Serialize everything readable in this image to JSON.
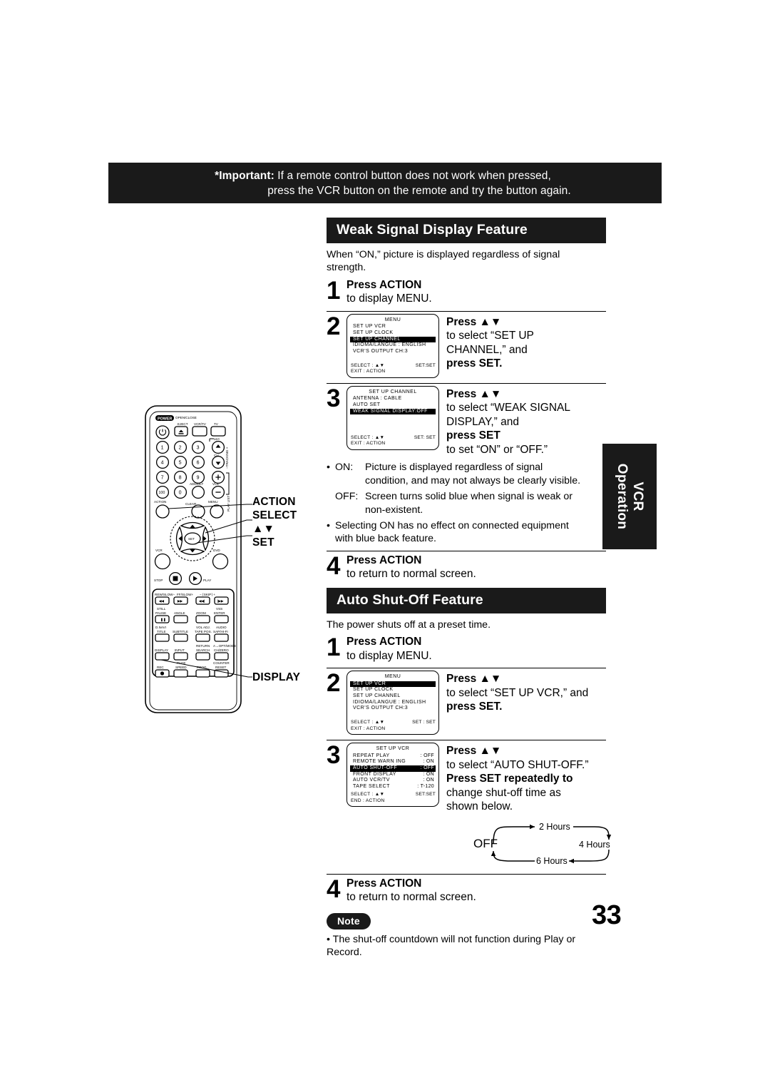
{
  "page": {
    "number": "33",
    "side_tab": "VCR\nOperation",
    "side_tab_line1": "VCR",
    "side_tab_line2": "Operation"
  },
  "important": {
    "label": "*Important:",
    "line1": " If a remote control button does not work when pressed,",
    "line2": "press the VCR button on the remote and try the button again."
  },
  "remote": {
    "callouts": [
      {
        "label": "ACTION"
      },
      {
        "label": "SELECT"
      },
      {
        "label": "▲▼"
      },
      {
        "label": "SET"
      }
    ],
    "display_callout": "DISPLAY",
    "buttons": {
      "power": "POWER",
      "open_close": "OPEN/CLOSE",
      "eject": "EJECT",
      "vcr_tv": "VCR/TV",
      "tv": "TV",
      "ch": "CH",
      "tracking": "TRACKING",
      "over10": "≥10",
      "add_dlt": "ADD/DLT",
      "vol": "VOL",
      "action": "ACTION",
      "clear": "CLEAR",
      "menu": "MENU",
      "play_list": "PLAY LIST",
      "set": "SET",
      "vcr": "VCR",
      "dvd": "DVD",
      "stop": "STOP",
      "play": "PLAY",
      "rew_slow": "REW/SLOW−",
      "ff_slow": "FF/SLOW+",
      "skip": "SKIP",
      "still_pause": "STILL PAUSE",
      "angle": "ANGLE",
      "zoom": "ZOOM",
      "vss_enter": "VSS ENTER",
      "dnavi_title": "D.NAVI TITLE",
      "subtitle": "SUBTITLE",
      "vol_adj_tape_pos": "VOL ADJ. TAPE POS.",
      "audio": "AUDIO SAP/HI-FI",
      "display": "DISPLAY",
      "input": "INPUT",
      "return_search": "RETURN SEARCH",
      "ch_zero": "A→ OPT/MODE CH/ZERO",
      "rec": "REC",
      "page_speed": "PAGE SPEED",
      "prog": "PROG",
      "counter_reset": "COUNTER RESET",
      "numbers": [
        "1",
        "2",
        "3",
        "4",
        "5",
        "6",
        "7",
        "8",
        "9",
        "100",
        "0"
      ]
    }
  },
  "sections": [
    {
      "title": "Weak Signal Display Feature",
      "intro": "When “ON,” picture is displayed regardless of signal strength.",
      "steps": [
        {
          "num": "1",
          "lines": [
            {
              "text": "Press ACTION",
              "bold": true
            },
            {
              "text": "to display MENU.",
              "bold": false
            }
          ]
        },
        {
          "num": "2",
          "lines": [
            {
              "text": "Press ▲▼",
              "bold": true
            },
            {
              "text": "to select “SET UP",
              "bold": false
            },
            {
              "text": "CHANNEL,” and",
              "bold": false
            },
            {
              "text": "press SET.",
              "bold": true
            }
          ],
          "osd": {
            "title": "MENU",
            "rows": [
              {
                "key": "SET  UP  VCR",
                "value": "",
                "highlight": false
              },
              {
                "key": "SET  UP  CLOCK",
                "value": "",
                "highlight": false
              },
              {
                "key": "SET  UP  CHANNEL",
                "value": "",
                "highlight": true
              },
              {
                "key": "IDIOMA/LANGUE : ENGLISH",
                "value": "",
                "highlight": false
              },
              {
                "key": "VCR’S  OUTPUT  CH:3",
                "value": "",
                "highlight": false
              }
            ],
            "footer": [
              {
                "left": "SELECT :  ▲▼",
                "right": "SET:SET"
              },
              {
                "left": "EXIT       : ACTION",
                "right": ""
              }
            ]
          }
        },
        {
          "num": "3",
          "lines": [
            {
              "text": "Press ▲▼",
              "bold": true
            },
            {
              "text": "to select “WEAK SIGNAL",
              "bold": false
            },
            {
              "text": "DISPLAY,” and",
              "bold": false
            },
            {
              "text": "press SET",
              "bold": true
            },
            {
              "text": "to set “ON” or “OFF.”",
              "bold": false
            }
          ],
          "osd": {
            "title": "SET  UP  CHANNEL",
            "rows": [
              {
                "key": "ANTENNA  :  CABLE",
                "value": "",
                "highlight": false
              },
              {
                "key": "AUTO  SET",
                "value": "",
                "highlight": false
              },
              {
                "key": "WEAK  SIGNAL  DISPLAY:OFF",
                "value": "",
                "highlight": true
              }
            ],
            "footer": [
              {
                "left": "SELECT : ▲▼",
                "right": "SET: SET"
              },
              {
                "left": "EXIT      : ACTION",
                "right": ""
              }
            ]
          }
        },
        {
          "num": "4",
          "lines": [
            {
              "text": "Press ACTION",
              "bold": true
            },
            {
              "text": "to return to normal screen.",
              "bold": false
            }
          ]
        }
      ],
      "bullets": [
        {
          "dot": "•",
          "tag": "ON:",
          "text": "Picture is displayed regardless of signal"
        },
        {
          "indent": true,
          "text": "condition, and may not always be clearly visible."
        },
        {
          "dot": "",
          "tag": "OFF:",
          "text": "Screen turns solid blue when signal is weak or"
        },
        {
          "indent": true,
          "text": "non-existent."
        },
        {
          "dot": "•",
          "tag": "",
          "text": "Selecting ON has no effect on connected equipment"
        },
        {
          "indent2": true,
          "text": "with blue back feature."
        }
      ]
    },
    {
      "title": "Auto Shut-Off Feature",
      "intro": "The power shuts off at a preset time.",
      "steps": [
        {
          "num": "1",
          "lines": [
            {
              "text": "Press ACTION",
              "bold": true
            },
            {
              "text": "to display MENU.",
              "bold": false
            }
          ]
        },
        {
          "num": "2",
          "lines": [
            {
              "text": "Press ▲▼",
              "bold": true
            },
            {
              "text": "to select “SET UP VCR,” and",
              "bold": false
            },
            {
              "text": "press SET.",
              "bold": true
            }
          ],
          "osd": {
            "title": "MENU",
            "rows": [
              {
                "key": "SET  UP  VCR",
                "value": "",
                "highlight": true
              },
              {
                "key": "SET  UP  CLOCK",
                "value": "",
                "highlight": false
              },
              {
                "key": "SET  UP  CHANNEL",
                "value": "",
                "highlight": false
              },
              {
                "key": "IDIOMA/LANGUE : ENGLISH",
                "value": "",
                "highlight": false
              },
              {
                "key": "VCR’S  OUTPUT  CH:3",
                "value": "",
                "highlight": false
              }
            ],
            "footer": [
              {
                "left": "SELECT :  ▲▼",
                "right": "SET : SET"
              },
              {
                "left": "EXIT       : ACTION",
                "right": ""
              }
            ]
          }
        },
        {
          "num": "3",
          "lines": [
            {
              "text": "Press ▲▼",
              "bold": true
            },
            {
              "text": "to select “AUTO SHUT-OFF.”",
              "bold": false
            },
            {
              "text": "Press SET repeatedly to",
              "bold": true
            },
            {
              "text": "change shut-off time as",
              "bold": false
            },
            {
              "text": "shown  below.",
              "bold": false
            }
          ],
          "osd": {
            "title": "SET  UP  VCR",
            "rows": [
              {
                "key": "REPEAT  PLAY",
                "value": ": OFF",
                "highlight": false
              },
              {
                "key": "REMOTE  WARN ING",
                "value": ": ON",
                "highlight": false
              },
              {
                "key": "AUTO  SHUT-OFF",
                "value": ": OFF",
                "highlight": true
              },
              {
                "key": "FRONT  DISPLAY",
                "value": ": ON",
                "highlight": false
              },
              {
                "key": "AUTO  VCR/TV",
                "value": ": ON",
                "highlight": false
              },
              {
                "key": "TAPE  SELECT",
                "value": ": T-120",
                "highlight": false
              }
            ],
            "footer": [
              {
                "left": "SELECT : ▲▼",
                "right": "SET:SET"
              },
              {
                "left": "END      : ACTION",
                "right": ""
              }
            ]
          }
        },
        {
          "num": "4",
          "lines": [
            {
              "text": "Press ACTION",
              "bold": true
            },
            {
              "text": "to return to normal screen.",
              "bold": false
            }
          ]
        }
      ],
      "cycle": {
        "off": "OFF",
        "top": "2 Hours",
        "right": "4 Hours",
        "bottom": "6 Hours"
      }
    }
  ],
  "note": {
    "badge": "Note",
    "bullet": "•",
    "text": "The shut-off countdown will not function during Play or Record."
  }
}
